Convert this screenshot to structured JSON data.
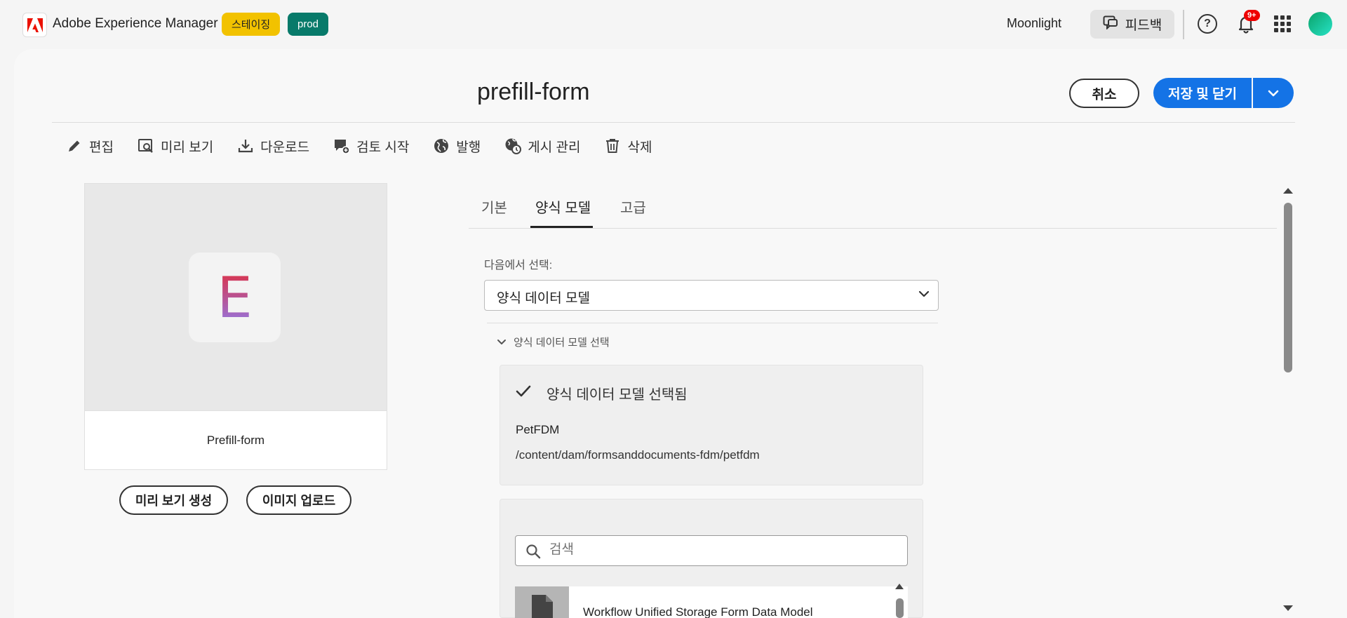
{
  "shell": {
    "app_name": "Adobe Experience Manager",
    "badge_staging": "스테이징",
    "badge_prod": "prod",
    "org_name": "Moonlight",
    "feedback_label": "피드백",
    "notifications_count": "9+",
    "help_glyph": "?"
  },
  "header": {
    "title": "prefill-form",
    "cancel_label": "취소",
    "save_label": "저장 및 닫기"
  },
  "toolbar": {
    "edit": "편집",
    "preview": "미리 보기",
    "download": "다운로드",
    "review": "검토 시작",
    "publish": "발행",
    "manage_publication": "게시 관리",
    "delete": "삭제"
  },
  "thumbnail": {
    "letter": "E",
    "name": "Prefill-form",
    "generate_preview_label": "미리 보기 생성",
    "upload_image_label": "이미지 업로드"
  },
  "tabs": [
    "기본",
    "양식 모델",
    "고급"
  ],
  "form_model": {
    "select_from_label": "다음에서 선택:",
    "select_value": "양식 데이터 모델",
    "accordion_label": "양식 데이터 모델 선택",
    "selected_status": "양식 데이터 모델 선택됨",
    "selected_name": "PetFDM",
    "selected_path": "/content/dam/formsanddocuments-fdm/petfdm",
    "search_placeholder": "검색",
    "results": [
      "Workflow Unified Storage Form Data Model"
    ]
  },
  "colors": {
    "accent": "#1473e6",
    "staging_badge": "#f2c200",
    "prod_badge": "#087a6a",
    "notification": "#e00000"
  }
}
